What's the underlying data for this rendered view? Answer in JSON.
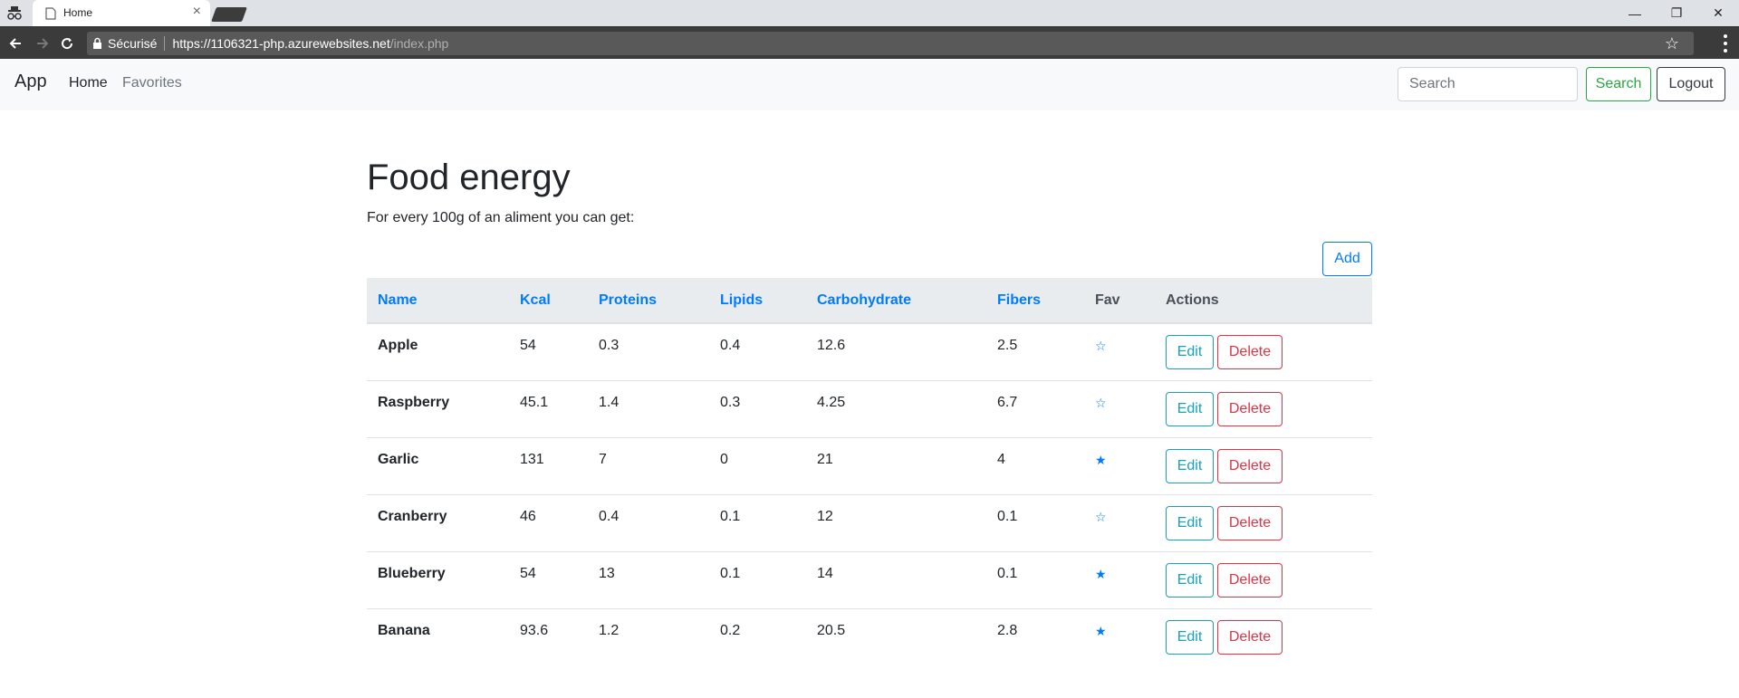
{
  "browser": {
    "tab_title": "Home",
    "secure_label": "Sécurisé",
    "url_host": "https://1106321-php.azurewebsites.net",
    "url_path": "/index.php"
  },
  "navbar": {
    "brand": "App",
    "links": [
      "Home",
      "Favorites"
    ],
    "search_placeholder": "Search",
    "search_button": "Search",
    "logout_button": "Logout"
  },
  "main": {
    "title": "Food energy",
    "subtitle": "For every 100g of an aliment you can get:",
    "add_button": "Add",
    "columns": [
      "Name",
      "Kcal",
      "Proteins",
      "Lipids",
      "Carbohydrate",
      "Fibers",
      "Fav",
      "Actions"
    ],
    "rows": [
      {
        "name": "Apple",
        "kcal": "54",
        "proteins": "0.3",
        "lipids": "0.4",
        "carbohydrate": "12.6",
        "fibers": "2.5",
        "fav": "☆"
      },
      {
        "name": "Raspberry",
        "kcal": "45.1",
        "proteins": "1.4",
        "lipids": "0.3",
        "carbohydrate": "4.25",
        "fibers": "6.7",
        "fav": "☆"
      },
      {
        "name": "Garlic",
        "kcal": "131",
        "proteins": "7",
        "lipids": "0",
        "carbohydrate": "21",
        "fibers": "4",
        "fav": "★"
      },
      {
        "name": "Cranberry",
        "kcal": "46",
        "proteins": "0.4",
        "lipids": "0.1",
        "carbohydrate": "12",
        "fibers": "0.1",
        "fav": "☆"
      },
      {
        "name": "Blueberry",
        "kcal": "54",
        "proteins": "13",
        "lipids": "0.1",
        "carbohydrate": "14",
        "fibers": "0.1",
        "fav": "★"
      },
      {
        "name": "Banana",
        "kcal": "93.6",
        "proteins": "1.2",
        "lipids": "0.2",
        "carbohydrate": "20.5",
        "fibers": "2.8",
        "fav": "★"
      }
    ],
    "edit_label": "Edit",
    "delete_label": "Delete"
  },
  "colors": {
    "primary": "#007bff",
    "success": "#28a745",
    "info": "#17a2b8",
    "danger": "#dc3545",
    "dark": "#343a40"
  }
}
